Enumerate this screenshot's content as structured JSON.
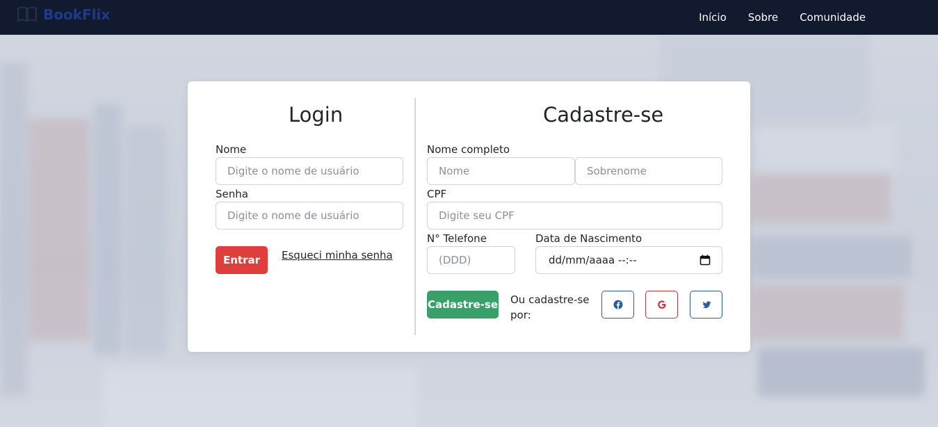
{
  "brand": {
    "name": "BookFlix",
    "icon": "book-icon"
  },
  "nav": {
    "items": [
      "Início",
      "Sobre",
      "Comunidade"
    ]
  },
  "login": {
    "title": "Login",
    "username_label": "Nome",
    "username_placeholder": "Digite o nome de usuário",
    "password_label": "Senha",
    "password_placeholder": "Digite o nome de usuário",
    "submit_label": "Entrar",
    "forgot_label": "Esqueci minha senha"
  },
  "register": {
    "title": "Cadastre-se",
    "fullname_label": "Nome completo",
    "first_name_placeholder": "Nome",
    "last_name_placeholder": "Sobrenome",
    "cpf_label": "CPF",
    "cpf_placeholder": "Digite seu CPF",
    "phone_label": "N° Telefone",
    "phone_placeholder": "(DDD)",
    "birth_label": "Data de Nascimento",
    "birth_value": "dd/mm/aaaa --:--",
    "submit_label": "Cadastre-se",
    "social_text": "Ou cadastre-se por:",
    "social_icons": [
      "facebook-icon",
      "google-icon",
      "twitter-icon"
    ]
  },
  "colors": {
    "navbar": "#111a2e",
    "brand": "#1f3a8a",
    "login_button": "#e03d3d",
    "register_button": "#3aa06a",
    "facebook": "#2b5d9a",
    "google": "#c0363a",
    "twitter": "#2b5d9a"
  }
}
